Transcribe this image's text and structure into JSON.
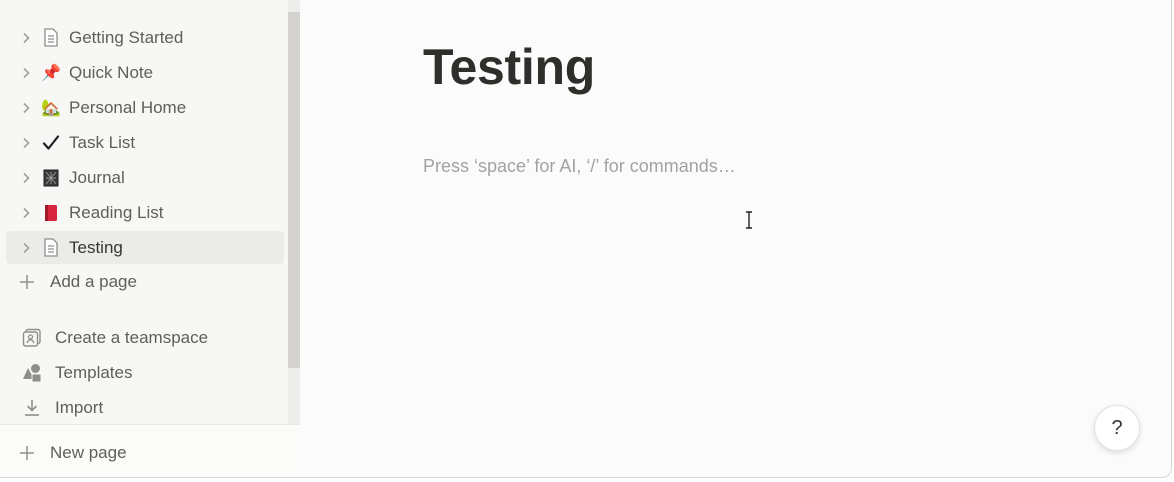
{
  "sidebar": {
    "pages": [
      {
        "label": "Getting Started",
        "icon": "page-icon"
      },
      {
        "label": "Quick Note",
        "icon": "pushpin-icon",
        "emoji": "📌"
      },
      {
        "label": "Personal Home",
        "icon": "house-icon",
        "emoji": "🏡"
      },
      {
        "label": "Task List",
        "icon": "checkmark-icon",
        "emoji": "✔"
      },
      {
        "label": "Journal",
        "icon": "notebook-icon",
        "emoji": "📓"
      },
      {
        "label": "Reading List",
        "icon": "book-icon",
        "emoji": "📕"
      },
      {
        "label": "Testing",
        "icon": "page-icon",
        "active": true
      }
    ],
    "add_page_label": "Add a page",
    "actions": [
      {
        "label": "Create a teamspace",
        "icon": "teamspace-icon"
      },
      {
        "label": "Templates",
        "icon": "shapes-icon"
      },
      {
        "label": "Import",
        "icon": "download-icon"
      }
    ],
    "new_page_label": "New page"
  },
  "main": {
    "title": "Testing",
    "editor_placeholder": "Press ‘space’ for AI, ‘/’ for commands…",
    "help_label": "?"
  },
  "colors": {
    "sidebar_bg": "#f7f7f5",
    "active_item_bg": "#ebebea",
    "title": "#2f2e2b",
    "placeholder": "#a3a29e"
  }
}
